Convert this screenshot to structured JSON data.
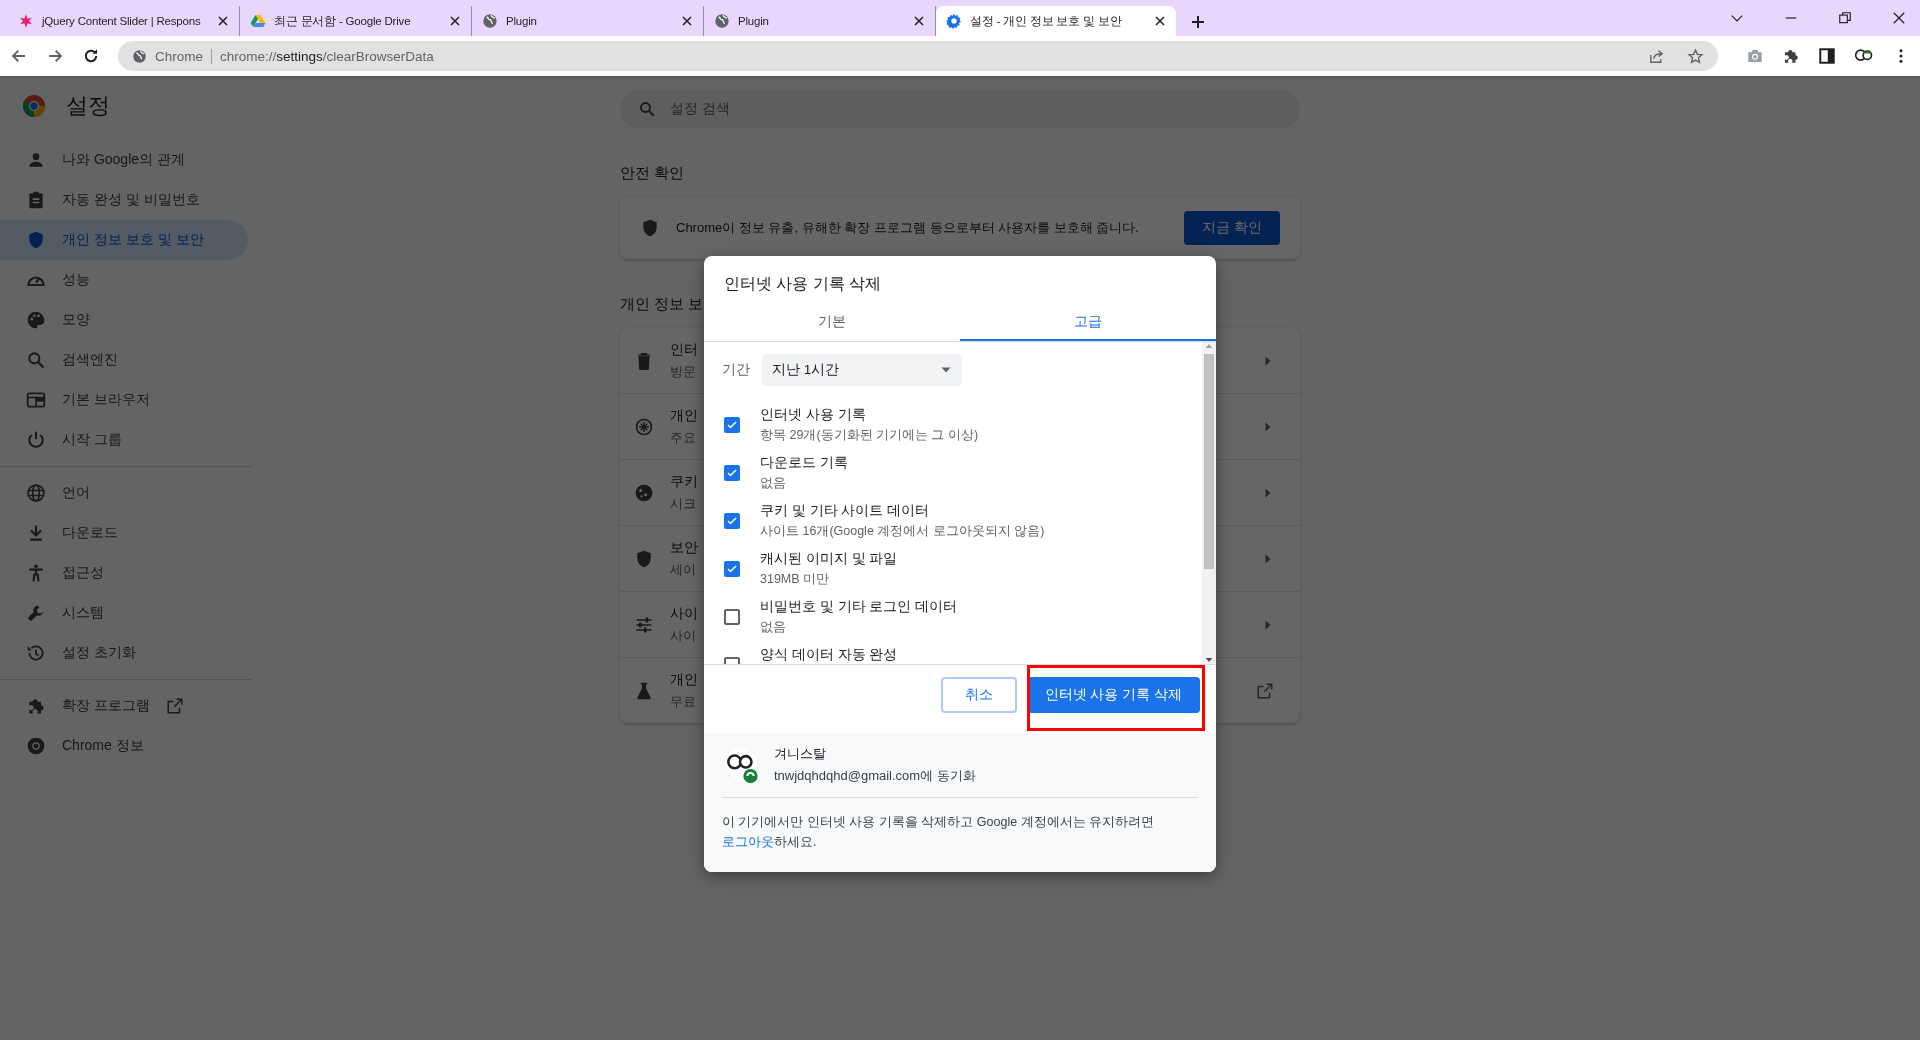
{
  "browser": {
    "tabs": [
      {
        "title": "jQuery Content Slider | Respons",
        "selected": false
      },
      {
        "title": "최근 문서함 - Google Drive",
        "selected": false
      },
      {
        "title": "Plugin",
        "selected": false
      },
      {
        "title": "Plugin",
        "selected": false
      },
      {
        "title": "설정 - 개인 정보 보호 및 보안",
        "selected": true
      }
    ],
    "site_label": "Chrome",
    "url_prefix": "chrome://",
    "url_host": "settings",
    "url_path": "/clearBrowserData"
  },
  "sidebar": {
    "title": "설정",
    "sections": [
      [
        {
          "label": "나와 Google의 관계",
          "selected": false
        },
        {
          "label": "자동 완성 및 비밀번호",
          "selected": false
        },
        {
          "label": "개인 정보 보호 및 보안",
          "selected": true
        },
        {
          "label": "성능",
          "selected": false
        },
        {
          "label": "모양",
          "selected": false
        },
        {
          "label": "검색엔진",
          "selected": false
        },
        {
          "label": "기본 브라우저",
          "selected": false
        },
        {
          "label": "시작 그룹",
          "selected": false
        }
      ],
      [
        {
          "label": "언어",
          "selected": false
        },
        {
          "label": "다운로드",
          "selected": false
        },
        {
          "label": "접근성",
          "selected": false
        },
        {
          "label": "시스템",
          "selected": false
        },
        {
          "label": "설정 초기화",
          "selected": false
        }
      ],
      [
        {
          "label": "확장 프로그램",
          "selected": false,
          "external": true
        },
        {
          "label": "Chrome 정보",
          "selected": false
        }
      ]
    ]
  },
  "main": {
    "search": {
      "placeholder": "설정 검색"
    },
    "safety_heading": "안전 확인",
    "safety_text": "Chrome이 정보 유출, 유해한 확장 프로그램 등으로부터 사용자를 보호해 줍니다.",
    "safety_button": "지금 확인",
    "privacy_heading": "개인 정보 보",
    "rows": [
      {
        "title": "인터",
        "subtitle": "방문",
        "kind": "arrow"
      },
      {
        "title": "개인",
        "subtitle": "주요",
        "kind": "arrow"
      },
      {
        "title": "쿠키",
        "subtitle": "시크",
        "kind": "arrow"
      },
      {
        "title": "보안",
        "subtitle": "세이",
        "kind": "arrow"
      },
      {
        "title": "사이",
        "subtitle": "사이",
        "kind": "arrow"
      },
      {
        "title": "개인",
        "subtitle": "무료",
        "kind": "external"
      }
    ]
  },
  "dialog": {
    "title": "인터넷 사용 기록 삭제",
    "tabs": [
      {
        "label": "기본",
        "selected": false
      },
      {
        "label": "고급",
        "selected": true
      }
    ],
    "period_label": "기간",
    "period_value": "지난 1시간",
    "items": [
      {
        "title": "인터넷 사용 기록",
        "detail": "항목 29개(동기화된 기기에는 그 이상)",
        "checked": true
      },
      {
        "title": "다운로드 기록",
        "detail": "없음",
        "checked": true
      },
      {
        "title": "쿠키 및 기타 사이트 데이터",
        "detail": "사이트 16개(Google 계정에서 로그아웃되지 않음)",
        "checked": true
      },
      {
        "title": "캐시된 이미지 및 파일",
        "detail": "319MB 미만",
        "checked": true
      },
      {
        "title": "비밀번호 및 기타 로그인 데이터",
        "detail": "없음",
        "checked": false
      },
      {
        "title": "양식 데이터 자동 완성",
        "checked": false
      }
    ],
    "cancel_button": "취소",
    "confirm_button": "인터넷 사용 기록 삭제",
    "confirm_highlighted": true,
    "account_name": "겨니스탈",
    "account_sync": "tnwjdqhdqhd@gmail.com에 동기화",
    "note_before": "이 기기에서만 인터넷 사용 기록을 삭제하고 Google 계정에서는 유지하려면 ",
    "note_link": "로그아웃",
    "note_after": "하세요."
  }
}
